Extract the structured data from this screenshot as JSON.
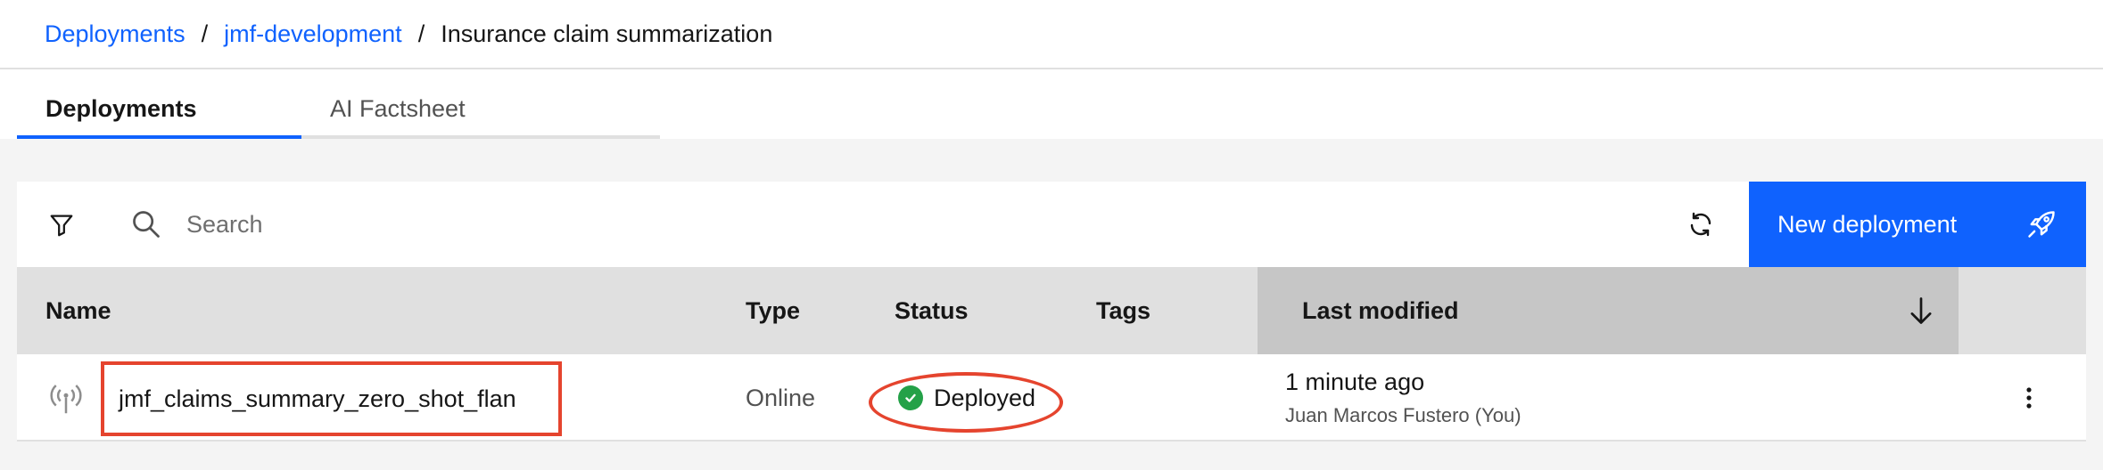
{
  "breadcrumb": {
    "items": [
      {
        "label": "Deployments"
      },
      {
        "label": "jmf-development"
      }
    ],
    "current": "Insurance claim summarization",
    "separator": "/"
  },
  "tabs": [
    {
      "label": "Deployments",
      "active": true
    },
    {
      "label": "AI Factsheet",
      "active": false
    }
  ],
  "toolbar": {
    "filter_icon": "filter-icon",
    "search_icon": "search-icon",
    "search_placeholder": "Search",
    "search_value": "",
    "refresh_icon": "refresh-icon",
    "new_deployment_label": "New deployment",
    "new_deployment_icon": "rocket-icon"
  },
  "table": {
    "columns": [
      "Name",
      "Type",
      "Status",
      "Tags",
      "Last modified"
    ],
    "sort_column": "Last modified",
    "sort_direction": "descending",
    "rows": [
      {
        "icon": "deployment-antenna-icon",
        "name": "jmf_claims_summary_zero_shot_flan",
        "type": "Online",
        "status": "Deployed",
        "tags": "",
        "last_modified": "1 minute ago",
        "modified_by": "Juan Marcos Fustero (You)"
      }
    ]
  },
  "colors": {
    "accent": "#0f62fe",
    "status_success": "#24a148",
    "annotation": "#e5442e",
    "header_bg": "#e0e0e0",
    "sorted_header_bg": "#c6c6c6",
    "panel_bg": "#f4f4f4"
  }
}
